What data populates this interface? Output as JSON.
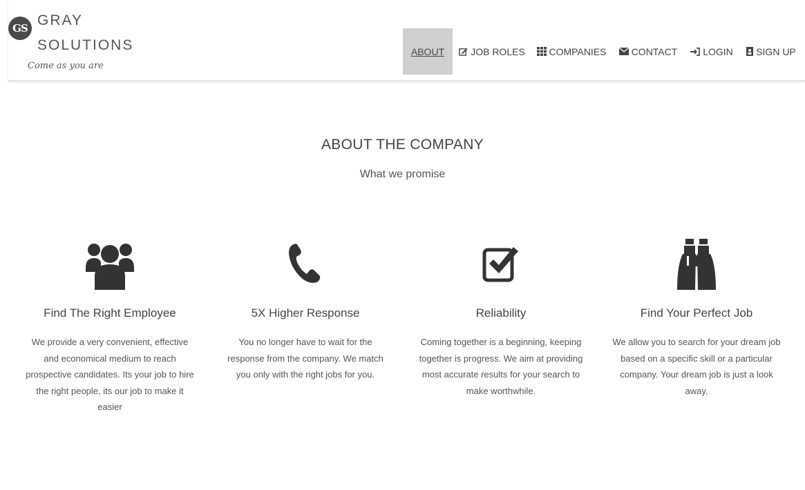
{
  "brand": {
    "line1": "GRAY",
    "line2": "SOLUTIONS",
    "tagline": "Come as you are",
    "mark": "GS"
  },
  "nav": {
    "about": "ABOUT",
    "job_roles": "JOB ROLES",
    "companies": "COMPANIES",
    "contact": "CONTACT",
    "login": "LOGIN",
    "signup": "SIGN UP",
    "active": "ABOUT"
  },
  "section": {
    "title": "ABOUT THE COMPANY",
    "subtitle": "What we promise"
  },
  "features": [
    {
      "icon": "users-icon",
      "title": "Find The Right Employee",
      "text": "We provide a very convenient, effective and economical medium to reach prospective candidates. Its your job to hire the right people, its our job to make it easier"
    },
    {
      "icon": "phone-icon",
      "title": "5X Higher Response",
      "text": "You no longer have to wait for the response from the company. We match you only with the right jobs for you."
    },
    {
      "icon": "check-square-icon",
      "title": "Reliability",
      "text": "Coming together is a beginning, keeping together is progress. We aim at providing most accurate results for your search to make worthwhile."
    },
    {
      "icon": "binoculars-icon",
      "title": "Find Your Perfect Job",
      "text": "We allow you to search for your dream job based on a specific skill or a particular company. Your dream job is just a look away."
    }
  ],
  "colors": {
    "icon": "#333333",
    "active_nav_bg": "#cfcfcf",
    "text": "#444444"
  }
}
